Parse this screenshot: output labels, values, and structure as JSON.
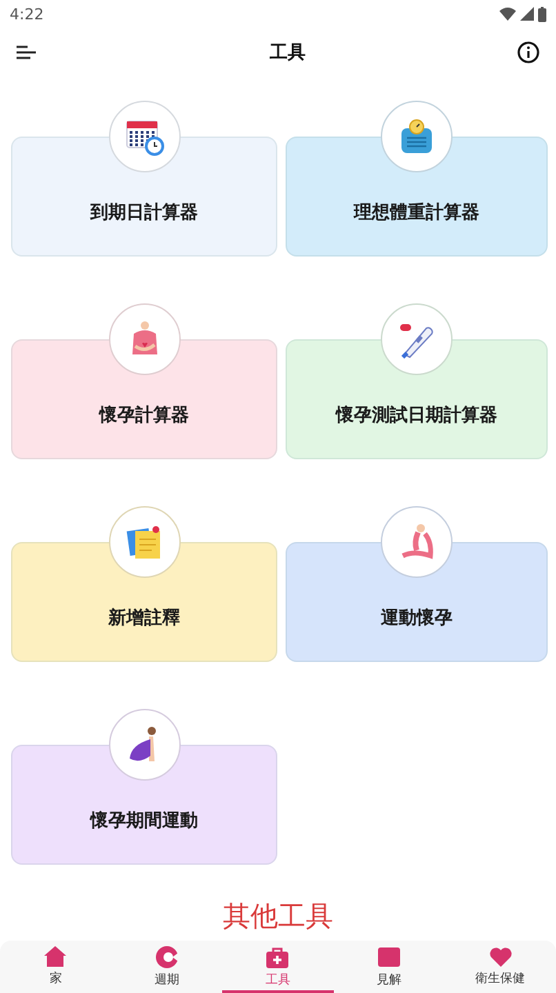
{
  "status_bar": {
    "time": "4:22"
  },
  "app_bar": {
    "title": "工具"
  },
  "tools": [
    {
      "label": "到期日計算器",
      "color": "#eef4fc"
    },
    {
      "label": "理想體重計算器",
      "color": "#d3ecfa"
    },
    {
      "label": "懷孕計算器",
      "color": "#fde3e8"
    },
    {
      "label": "懷孕測試日期計算器",
      "color": "#e1f6e3"
    },
    {
      "label": "新增註釋",
      "color": "#fdf0c0"
    },
    {
      "label": "運動懷孕",
      "color": "#d6e4fb"
    },
    {
      "label": "懷孕期間運動",
      "color": "#eee0fc"
    }
  ],
  "section_title": "其他工具",
  "nav": [
    {
      "label": "家",
      "selected": false
    },
    {
      "label": "週期",
      "selected": false
    },
    {
      "label": "工具",
      "selected": true
    },
    {
      "label": "見解",
      "selected": false
    },
    {
      "label": "衛生保健",
      "selected": false
    }
  ]
}
